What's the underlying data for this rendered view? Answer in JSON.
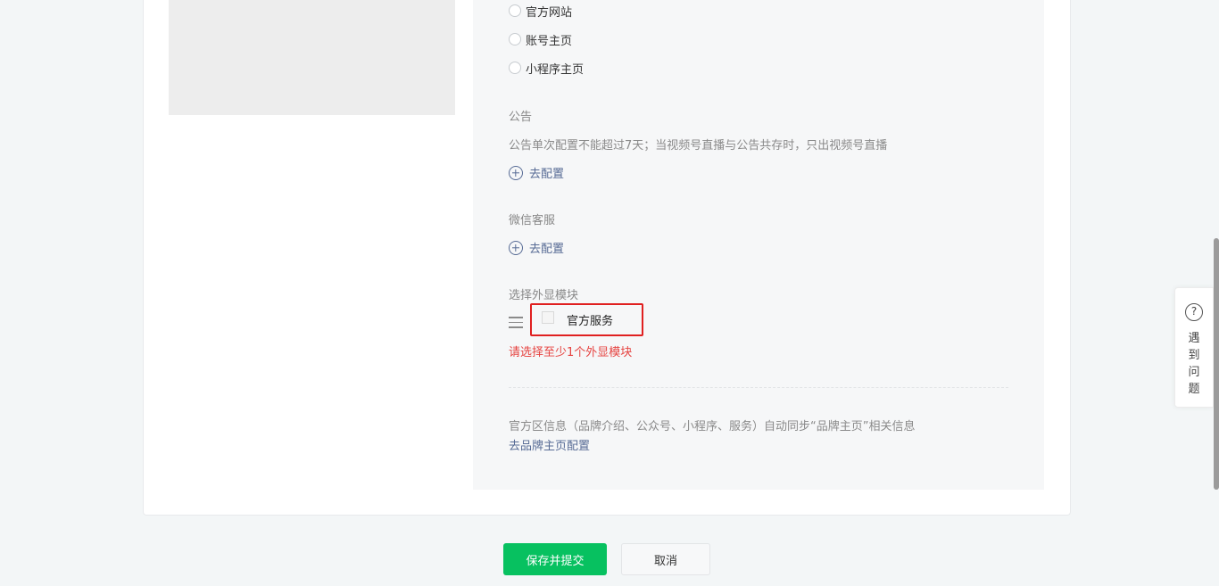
{
  "link_options": [
    "官方网站",
    "账号主页",
    "小程序主页"
  ],
  "announcement": {
    "title": "公告",
    "note": "公告单次配置不能超过7天；当视频号直播与公告共存时，只出视频号直播",
    "config_label": "去配置"
  },
  "wechat_service": {
    "title": "微信客服",
    "config_label": "去配置"
  },
  "display_module": {
    "title": "选择外显模块",
    "item_label": "官方服务",
    "error": "请选择至少1个外显模块"
  },
  "sync_info": {
    "note": "官方区信息（品牌介绍、公众号、小程序、服务）自动同步“品牌主页”相关信息",
    "link": "去品牌主页配置"
  },
  "actions": {
    "submit": "保存并提交",
    "cancel": "取消"
  },
  "help": {
    "icon_glyph": "?",
    "chars": [
      "遇",
      "到",
      "问",
      "题"
    ]
  },
  "colors": {
    "primary_green": "#07c160",
    "link_blue": "#576b95",
    "error_red": "#e64340",
    "highlight_border": "#e02020"
  }
}
